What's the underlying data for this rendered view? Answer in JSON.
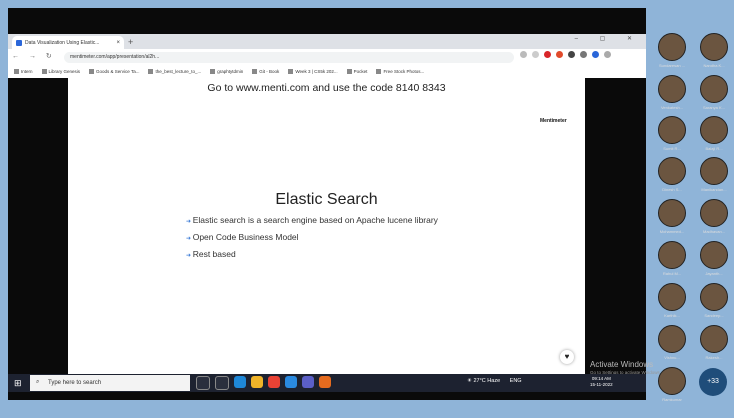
{
  "browser": {
    "tab_title": "Data Visualization Using Elastic...",
    "url": "mentimeter.com/app/presentation/al2h...",
    "bookmarks": [
      "Intern",
      "Library Genesis",
      "Goods & Service Ta...",
      "the_best_lecture_to_...",
      "graphtytdmin",
      "Git - Book",
      "Week 3 | CS5k 202...",
      "Pocket",
      "Free Stock Photos..."
    ]
  },
  "slide": {
    "menti_instruction": "Go to www.menti.com and use the code 8140 8343",
    "brand": "Mentimeter",
    "title": "Elastic Search",
    "bullets": [
      "Elastic search is a search engine based on Apache lucene library",
      "Open Code Business Model",
      "Rest based"
    ]
  },
  "taskbar": {
    "search_placeholder": "Type here to search",
    "weather": "27°C Haze",
    "language": "ENG",
    "time": "09:14 AM",
    "date": "15-11-2022"
  },
  "watermark": {
    "title": "Activate Windows",
    "subtitle": "Go to Settings to activate Windows."
  },
  "participants": [
    "Sundaresan ...",
    "Nandha K...",
    "Venkatesh...",
    "Saranya K...",
    "Sumit R...",
    "Balaji R...",
    "Dinesh S...",
    "Manikandan...",
    "Mohammed...",
    "Madhavan...",
    "Rahul M...",
    "Jayanth...",
    "Karthik...",
    "Sandeep...",
    "Vishnu...",
    "Rakesh...",
    "Ramkumar"
  ],
  "more_participants": "+33"
}
